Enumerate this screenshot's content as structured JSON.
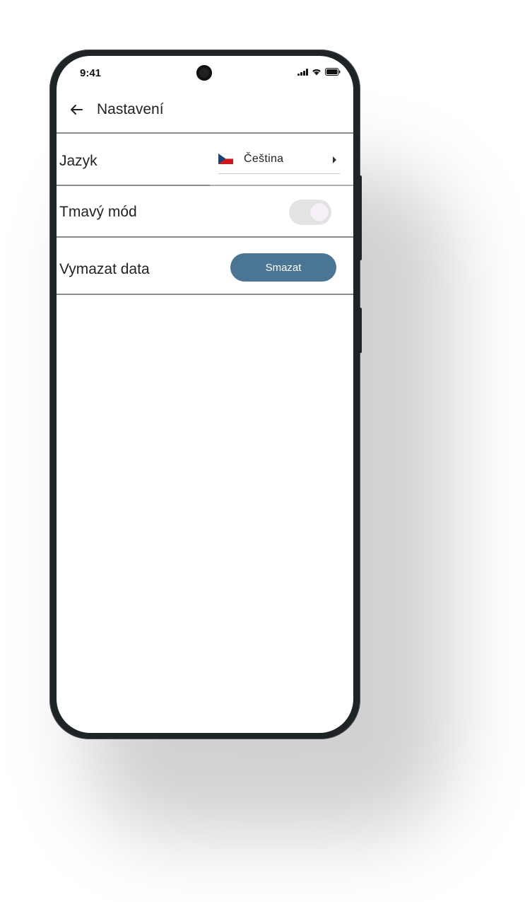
{
  "status_bar": {
    "time": "9:41"
  },
  "header": {
    "back_icon": "arrow-left-icon",
    "title": "Nastavení"
  },
  "settings": {
    "language": {
      "label": "Jazyk",
      "value": "Čeština",
      "flag_icon": "czech-flag-icon"
    },
    "dark_mode": {
      "label": "Tmavý mód",
      "enabled": false
    },
    "clear_data": {
      "label": "Vymazat data",
      "button_label": "Smazat"
    }
  },
  "colors": {
    "accent_button": "#4b7594",
    "toggle_track": "#e3e3e3",
    "divider": "#8c8c8c",
    "text": "#222222"
  }
}
